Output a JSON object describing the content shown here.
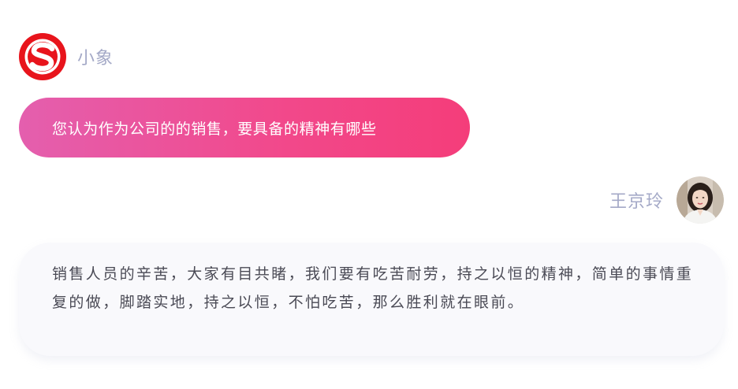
{
  "bot": {
    "name": "小象",
    "logo_icon": "red-s-logo-icon"
  },
  "question": {
    "text": "您认为作为公司的的销售，要具备的精神有哪些"
  },
  "user": {
    "name": "王京玲",
    "avatar_icon": "user-avatar-photo"
  },
  "answer": {
    "text": "销售人员的辛苦，大家有目共睹，我们要有吃苦耐劳，持之以恒的精神，简单的事情重复的做，脚踏实地，持之以恒，不怕吃苦，那么胜利就在眼前。"
  },
  "colors": {
    "bubble_gradient_start": "#e45fae",
    "bubble_gradient_end": "#f43d7a",
    "name_color": "#a4a9c7",
    "logo_red": "#e8141c",
    "card_bg": "#f9f9fc"
  }
}
